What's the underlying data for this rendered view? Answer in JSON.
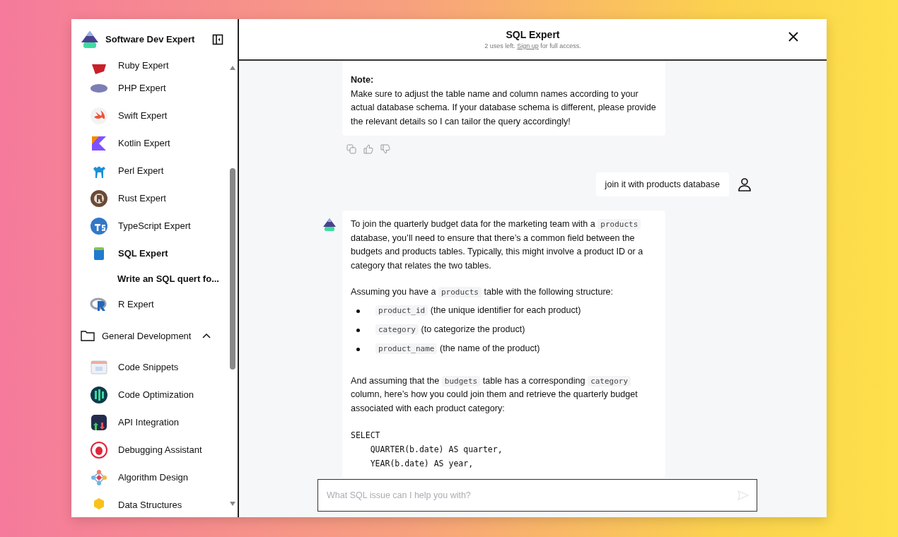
{
  "sidebar": {
    "title": "Software Dev Expert",
    "items": [
      {
        "label": "Ruby Expert",
        "kind": "gem",
        "selected": false
      },
      {
        "label": "PHP Expert",
        "kind": "oval",
        "selected": false
      },
      {
        "label": "Swift Expert",
        "kind": "bird",
        "selected": false
      },
      {
        "label": "Kotlin Expert",
        "kind": "kotlin",
        "selected": false
      },
      {
        "label": "Perl Expert",
        "kind": "camel",
        "selected": false
      },
      {
        "label": "Rust Expert",
        "kind": "gear",
        "selected": false
      },
      {
        "label": "TypeScript Expert",
        "kind": "tscircle",
        "selected": false
      },
      {
        "label": "SQL Expert",
        "kind": "database",
        "selected": true
      },
      {
        "label": "Write an SQL quert fo...",
        "kind": "chat",
        "selected": true
      },
      {
        "label": "R Expert",
        "kind": "ring",
        "selected": false
      }
    ],
    "folder": {
      "label": "General Development",
      "expanded": true,
      "items": [
        {
          "label": "Code Snippets",
          "kind": "window",
          "selected": false
        },
        {
          "label": "Code Optimization",
          "kind": "binary",
          "selected": false
        },
        {
          "label": "API Integration",
          "kind": "api",
          "selected": false
        },
        {
          "label": "Debugging Assistant",
          "kind": "bug",
          "selected": false
        },
        {
          "label": "Algorithm Design",
          "kind": "network",
          "selected": false
        },
        {
          "label": "Data Structures",
          "kind": "hexagon",
          "selected": false
        }
      ]
    }
  },
  "chat": {
    "title": "SQL Expert",
    "subtitle": [
      {
        "kind": "text",
        "text": "2 uses left. "
      },
      {
        "kind": "link",
        "text": "Sign up"
      },
      {
        "kind": "text",
        "text": " for full access."
      }
    ],
    "messages": [
      {
        "kind": "bot",
        "avatar": false,
        "actions": true,
        "blocks": [
          {
            "kind": "heading",
            "text": "Note:"
          },
          {
            "kind": "para",
            "segments": [
              {
                "kind": "text",
                "text": "Make sure to adjust the table name and column names according to your actual database schema. If your database schema is different, please provide the relevant details so I can tailor the query accordingly!"
              }
            ]
          }
        ]
      },
      {
        "kind": "user",
        "text": "join it with products database"
      },
      {
        "kind": "bot",
        "avatar": true,
        "actions": false,
        "blocks": [
          {
            "kind": "para",
            "segments": [
              {
                "kind": "text",
                "text": "To join the quarterly budget data for the marketing team with a "
              },
              {
                "kind": "code",
                "text": "products"
              },
              {
                "kind": "text",
                "text": " database, you’ll need to ensure that there’s a common field between the budgets and products tables. Typically, this might involve a product ID or a category that relates the two tables."
              }
            ]
          },
          {
            "kind": "para",
            "segments": [
              {
                "kind": "text",
                "text": "Assuming you have a "
              },
              {
                "kind": "code",
                "text": "products"
              },
              {
                "kind": "text",
                "text": " table with the following structure:"
              }
            ]
          },
          {
            "kind": "list",
            "items": [
              [
                {
                  "kind": "code",
                  "text": "product_id"
                },
                {
                  "kind": "text",
                  "text": " (the unique identifier for each product)"
                }
              ],
              [
                {
                  "kind": "code",
                  "text": "category"
                },
                {
                  "kind": "text",
                  "text": " (to categorize the product)"
                }
              ],
              [
                {
                  "kind": "code",
                  "text": "product_name"
                },
                {
                  "kind": "text",
                  "text": " (the name of the product)"
                }
              ]
            ]
          },
          {
            "kind": "para",
            "segments": [
              {
                "kind": "text",
                "text": "And assuming that the "
              },
              {
                "kind": "code",
                "text": "budgets"
              },
              {
                "kind": "text",
                "text": " table has a corresponding "
              },
              {
                "kind": "code",
                "text": "category"
              },
              {
                "kind": "text",
                "text": " column, here’s how you could join them and retrieve the quarterly budget associated with each product category:"
              }
            ]
          },
          {
            "kind": "code",
            "lines": [
              "SELECT",
              "    QUARTER(b.date) AS quarter,",
              "    YEAR(b.date) AS year,"
            ]
          }
        ]
      }
    ],
    "input": {
      "placeholder": "What SQL issue can I help you with?"
    }
  }
}
